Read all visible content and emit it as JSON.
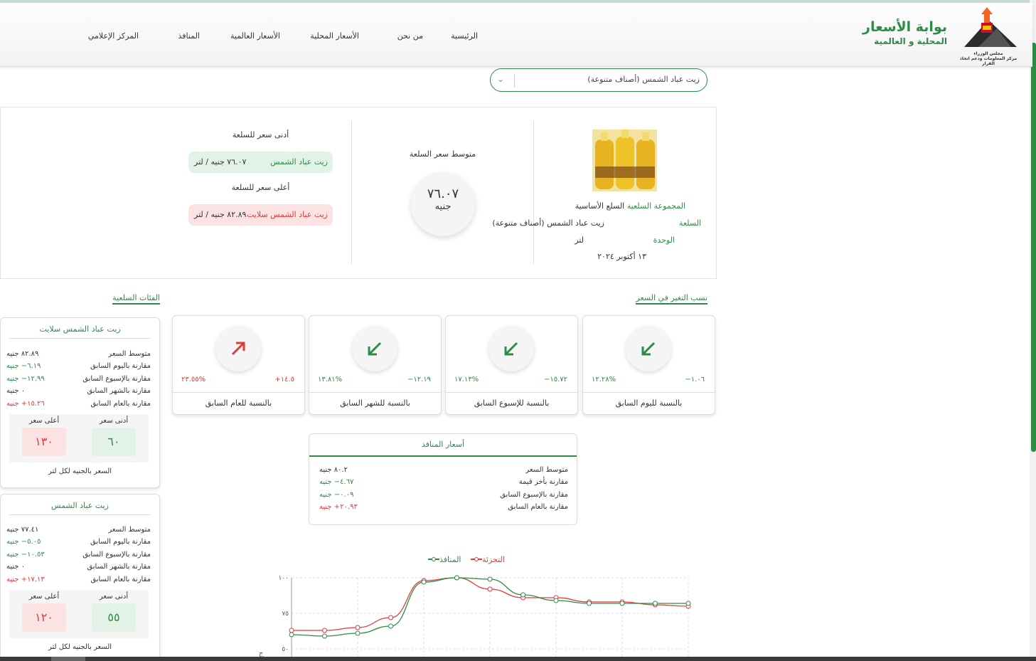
{
  "nav": {
    "items": [
      "الرئيسية",
      "من نحن",
      "الأسعار المحلية",
      "الأسعار العالمية",
      "المنافذ",
      "المركز الإعلامي"
    ]
  },
  "brand": {
    "title": "بوابة الأسعار",
    "subtitle": "المحلية و العالمية",
    "logo_caption_1": "مجلس الوزراء",
    "logo_caption_2": "مركز المعلومات ودعم اتخاذ القرار"
  },
  "commodity_select": {
    "value": "زيت عباد الشمس (أصناف متنوعة)"
  },
  "summary": {
    "group_label": "المجموعة السلعية",
    "group_value": "السلع الأساسية",
    "commodity_label": "السلعة",
    "commodity_value": "زيت عباد الشمس (أصناف متنوعة)",
    "unit_label": "الوحدة",
    "unit_value": "لتر",
    "date": "١٣ أكتوبر ٢٠٢٤",
    "avg_title": "متوسط سعر السلعة",
    "avg_value": "٧٦.٠٧",
    "avg_unit": "جنيه",
    "min_title": "أدنى سعر للسلعة",
    "min_name": "زيت عباد الشمس",
    "min_price": "٧٦.٠٧ جنيه / لتر",
    "max_title": "أعلى سعر للسلعة",
    "max_name": "زيت عباد الشمس سلايت",
    "max_price": "٨٢.٨٩ جنيه / لتر"
  },
  "sections": {
    "change_rates": "نسب التغير في السعر",
    "categories": "الفئات السلعية"
  },
  "change_cards": [
    {
      "value": "١.٠٦−",
      "pct": "%١٢.٢٨",
      "label": "بالنسبة لليوم السابق",
      "direction": "down",
      "color": "#2e8b47"
    },
    {
      "value": "١٥.٧٢−",
      "pct": "%١٧.١٣",
      "label": "بالنسبة للإسبوع السابق",
      "direction": "down",
      "color": "#2e8b47"
    },
    {
      "value": "١٢.١٩−",
      "pct": "%١٣.٨١",
      "label": "بالنسبة للشهر السابق",
      "direction": "down",
      "color": "#2e8b47"
    },
    {
      "value": "١٤.٥+",
      "pct": "%٢٣.٥٥",
      "label": "بالنسبة للعام السابق",
      "direction": "up",
      "color": "#e03b3b"
    }
  ],
  "category_cards": [
    {
      "title": "زيت عباد الشمس سلايت",
      "rows": [
        {
          "k": "متوسط السعر",
          "v": "٨٢.٨٩ جنيه",
          "c": "#333"
        },
        {
          "k": "مقارنة باليوم السابق",
          "v": "٦.١٩− جنيه",
          "c": "#2e8b47"
        },
        {
          "k": "مقارنة بالإسبوع السابق",
          "v": "١٢.٩٩− جنيه",
          "c": "#2e8b47"
        },
        {
          "k": "مقارنة بالشهر السابق",
          "v": "٠ جنيه",
          "c": "#333"
        },
        {
          "k": "مقارنة بالعام السابق",
          "v": "١٥.٢٦+ جنيه",
          "c": "#e03b3b"
        }
      ],
      "min_label": "أدنى سعر",
      "min_value": "٦٠",
      "max_label": "أعلى سعر",
      "max_value": "١٣٠",
      "footer": "السعر بالجنيه لكل لتر"
    },
    {
      "title": "زيت عباد الشمس",
      "rows": [
        {
          "k": "متوسط السعر",
          "v": "٧٧.٤١ جنيه",
          "c": "#333"
        },
        {
          "k": "مقارنة باليوم السابق",
          "v": "٥.٠٥− جنيه",
          "c": "#2e8b47"
        },
        {
          "k": "مقارنة بالإسبوع السابق",
          "v": "١٠.٥٣− جنيه",
          "c": "#2e8b47"
        },
        {
          "k": "مقارنة بالشهر السابق",
          "v": "٠ جنيه",
          "c": "#333"
        },
        {
          "k": "مقارنة بالعام السابق",
          "v": "١٧.١٣+ جنيه",
          "c": "#e03b3b"
        }
      ],
      "min_label": "أدنى سعر",
      "min_value": "٥٥",
      "max_label": "أعلى سعر",
      "max_value": "١٢٠",
      "footer": "السعر بالجنيه لكل لتر"
    }
  ],
  "ports": {
    "title": "أسعار المنافذ",
    "rows": [
      {
        "k": "متوسط السعر",
        "v": "٨٠.٢ جنيه",
        "c": "#333"
      },
      {
        "k": "مقارنة بأخر قيمة",
        "v": "٤.٦٧− جنيه",
        "c": "#2e8b47"
      },
      {
        "k": "مقارنة بالإسبوع السابق",
        "v": "٠.٠٩− جنيه",
        "c": "#2e8b47"
      },
      {
        "k": "مقارنة بالعام السابق",
        "v": "٢٠.٩٣+ جنيه",
        "c": "#e03b3b"
      }
    ]
  },
  "chart_data": {
    "type": "line",
    "ylim": [
      50,
      100
    ],
    "yticks": [
      "٥٠",
      "٧٥",
      "١٠٠"
    ],
    "y_axis_fragment": "ج",
    "x": [
      1,
      2,
      3,
      4,
      5,
      6,
      7,
      8,
      9,
      10,
      11,
      12,
      13
    ],
    "series": [
      {
        "name": "التجزئة",
        "color": "#e03b3b",
        "values": [
          63,
          63,
          65,
          72,
          98,
          100,
          92,
          86,
          86,
          83,
          83,
          81,
          80
        ]
      },
      {
        "name": "المنافذ",
        "color": "#2e8b47",
        "values": [
          60,
          59,
          61,
          66,
          97,
          100,
          99,
          88,
          84,
          82,
          82,
          82,
          82
        ]
      }
    ]
  }
}
